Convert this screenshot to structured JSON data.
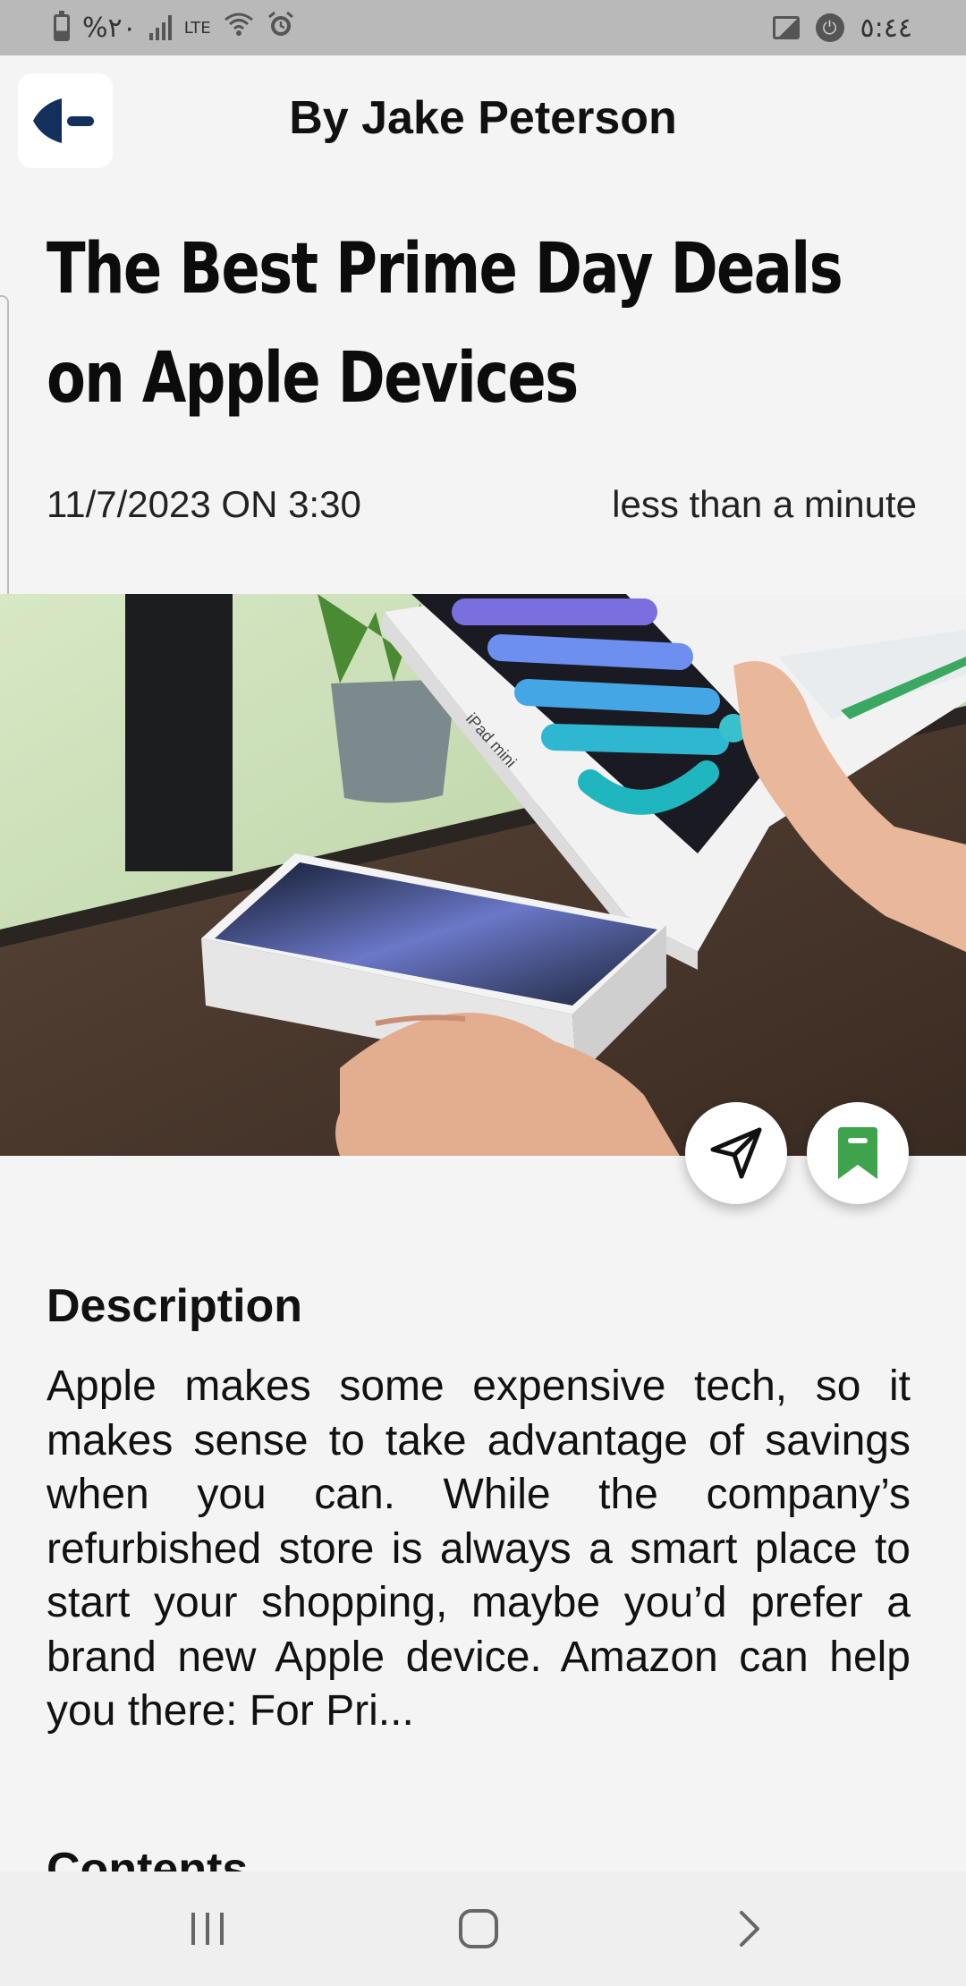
{
  "status_bar": {
    "battery_text": "%٢٠",
    "time": "٥:٤٤",
    "icons": [
      "battery-icon",
      "signal-icon",
      "lte-icon",
      "wifi-icon",
      "alarm-icon",
      "gallery-icon",
      "vpn-icon"
    ]
  },
  "header": {
    "author": "By Jake Peterson",
    "back_icon": "back-arrow-icon"
  },
  "article": {
    "title": "The Best Prime Day Deals on Apple Devices",
    "date": "11/7/2023 ON 3:30",
    "read_time": "less than a minute",
    "image_alt": "iPad mini boxes on a wooden table",
    "box_text": "iPad mini"
  },
  "actions": {
    "share_icon": "send-icon",
    "bookmark_icon": "bookmark-icon",
    "bookmark_color": "#3fa34d"
  },
  "description": {
    "heading": "Description",
    "body": "Apple makes some expensive tech, so it makes sense to take advantage of savings when you can. While the company’s refurbished store is always a smart place to start your shopping, maybe you’d prefer a brand new Apple device. Amazon can help you there: For Pri..."
  },
  "contents": {
    "heading": "Contents"
  },
  "nav_bar": {
    "recents_icon": "recents-icon",
    "home_icon": "home-icon",
    "back_icon": "chevron-right-icon"
  },
  "colors": {
    "accent_dark_blue": "#14305c",
    "bookmark_green": "#3fa34d"
  }
}
